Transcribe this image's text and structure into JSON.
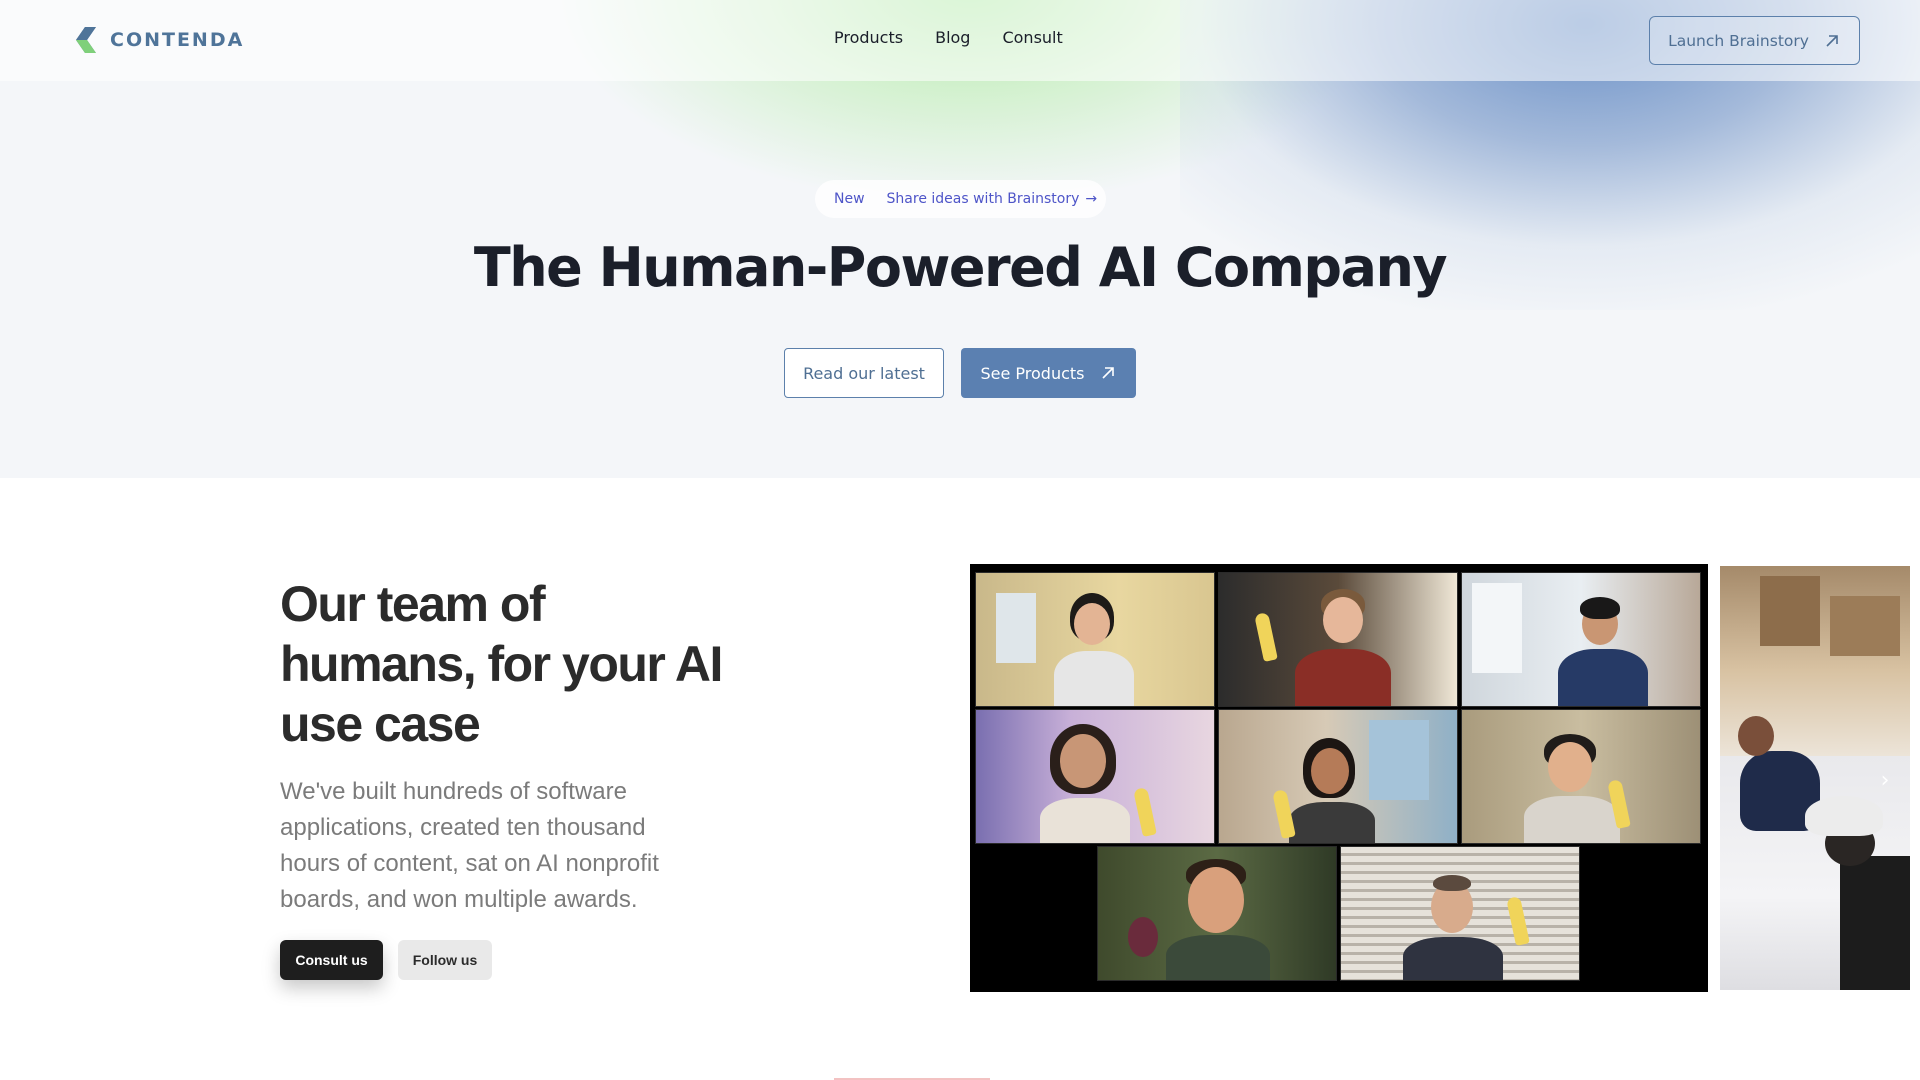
{
  "brand": {
    "name": "CONTENDA"
  },
  "nav": {
    "links": [
      "Products",
      "Blog",
      "Consult"
    ],
    "launch_label": "Launch Brainstory"
  },
  "hero": {
    "pill_new": "New",
    "pill_text": "Share ideas with Brainstory",
    "pill_arrow": "→",
    "title": "The Human-Powered AI Company",
    "read_label": "Read our latest",
    "products_label": "See Products"
  },
  "team": {
    "heading": "Our team of humans, for your AI use case",
    "description": "We've built hundreds of software applications, created ten thousand hours of content, sat on AI nonprofit boards, and won multiple awards.",
    "consult_label": "Consult us",
    "follow_label": "Follow us"
  },
  "carousel": {
    "next_glyph": "›"
  },
  "colors": {
    "accent": "#5b80b1",
    "pill_text": "#4e55c8",
    "logo": "#4f7499"
  }
}
